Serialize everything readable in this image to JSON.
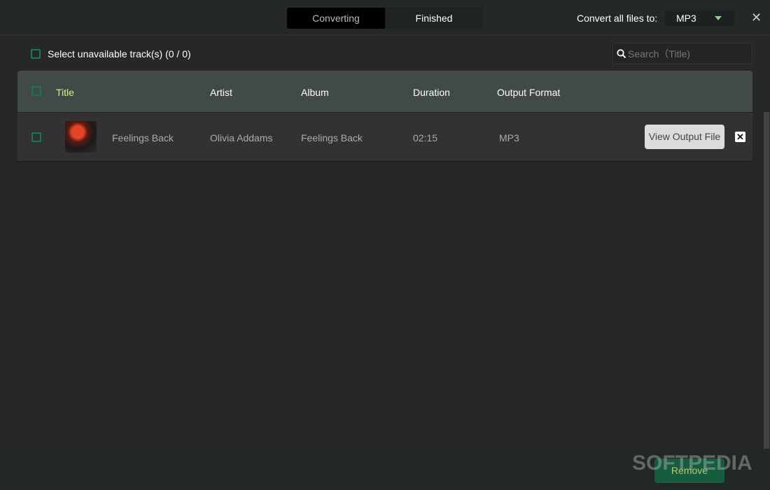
{
  "header": {
    "tabs": [
      {
        "label": "Converting",
        "active": true
      },
      {
        "label": "Finished",
        "active": false
      }
    ],
    "convert_label": "Convert all files to:",
    "format_value": "MP3",
    "close_icon": "close-icon"
  },
  "toolbar": {
    "select_unavailable": "Select unavailable track(s) (0 / 0)",
    "search_placeholder": "Search（Title)"
  },
  "table": {
    "columns": [
      "Title",
      "Artist",
      "Album",
      "Duration",
      "Output Format"
    ],
    "rows": [
      {
        "title": "Feelings Back",
        "artist": "Olivia Addams",
        "album": "Feelings Back",
        "duration": "02:15",
        "format": "MP3",
        "action": "View Output File"
      }
    ]
  },
  "footer": {
    "remove_label": "Remove",
    "watermark": "SOFTPEDIA"
  },
  "colors": {
    "accent": "#137a55",
    "title_header": "#d4ef8c",
    "remove_bg": "#165c3f"
  }
}
